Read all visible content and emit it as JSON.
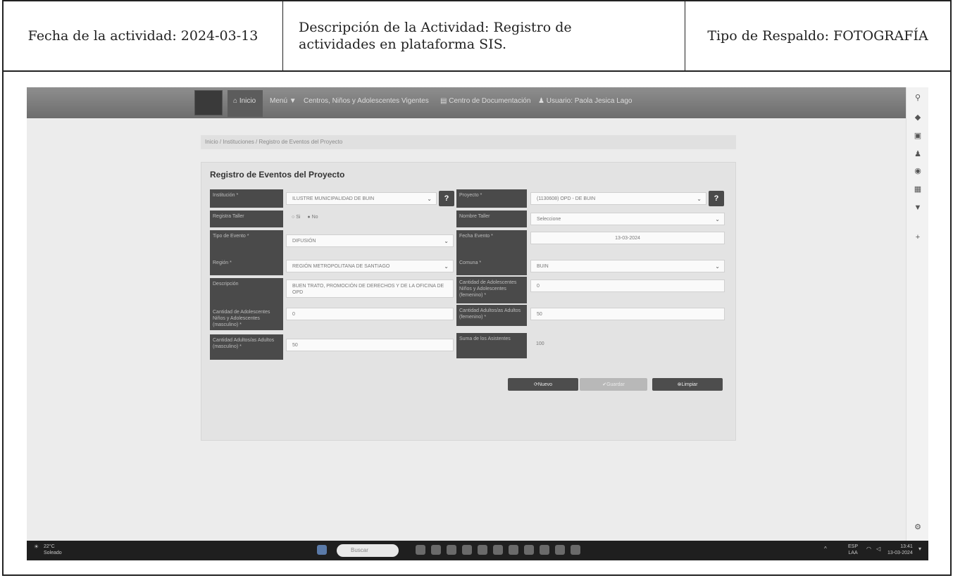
{
  "document": {
    "activity_date": "Fecha de la actividad: 2024-03-13",
    "activity_description_line1": "Descripción de la Actividad: Registro de",
    "activity_description_line2": "actividades en plataforma SIS.",
    "backup_type": "Tipo de Respaldo: FOTOGRAFÍA"
  },
  "navbar": {
    "home": "Inicio",
    "menu": "Menú ▼",
    "centers": "Centros, Niños y Adolescentes Vigentes",
    "docs": "Centro de Documentación",
    "user": "Usuario: Paola Jesica Lago"
  },
  "breadcrumb": {
    "items": [
      "Inicio",
      "Instituciones",
      "Registro de Eventos del Proyecto"
    ],
    "text": "Inicio / Instituciones / Registro de Eventos del Proyecto"
  },
  "form": {
    "title": "Registro de Eventos del Proyecto",
    "institucion_label": "Institución *",
    "institucion_value": "ILUSTRE MUNICIPALIDAD DE BUIN",
    "proyecto_label": "Proyecto *",
    "proyecto_value": "(1130608) OPD - DE BUIN",
    "registra_taller_label": "Registra Taller",
    "radio_si": "Si",
    "radio_no": "No",
    "nombre_taller_label": "Nombre Taller",
    "nombre_taller_value": "Seleccione",
    "tipo_evento_label": "Tipo de Evento *",
    "tipo_evento_value": "DIFUSIÓN",
    "fecha_evento_label": "Fecha Evento *",
    "fecha_evento_value": "13-03-2024",
    "region_label": "Región *",
    "region_value": "REGIÓN METROPOLITANA DE SANTIAGO",
    "comuna_label": "Comuna *",
    "comuna_value": "BUIN",
    "descripcion_label": "Descripción",
    "descripcion_value": "BUEN TRATO, PROMOCIÓN DE DERECHOS Y DE LA OFICINA DE OPD",
    "cant_nna_fem_label": "Cantidad de Adolescentes Niños y Adolescentes (femenino) *",
    "cant_nna_fem_value": "0",
    "cant_nna_masc_label": "Cantidad de Adolescentes Niños y Adolescentes (masculino) *",
    "cant_nna_masc_value": "0",
    "cant_adultos_fem_label": "Cantidad Adultos/as Adultos (femenino) *",
    "cant_adultos_fem_value": "50",
    "cant_adultos_masc_label": "Cantidad Adultos/as Adultos (masculino) *",
    "cant_adultos_masc_value": "50",
    "suma_label": "Suma de los Asistentes",
    "suma_value": "100",
    "btn_nuevo": "Nuevo",
    "btn_guardar": "Guardar",
    "btn_limpiar": "Limpiar"
  },
  "taskbar": {
    "weather_temp": "22°C",
    "weather_desc": "Soleado",
    "search_placeholder": "Buscar",
    "lang": "ESP",
    "lang2": "LAA",
    "time": "13:41",
    "date": "13-03-2024"
  }
}
